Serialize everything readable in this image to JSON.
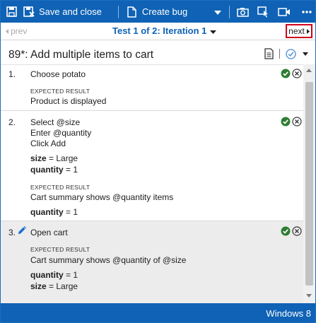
{
  "toolbar": {
    "save_close_label": "Save and close",
    "create_bug_label": "Create bug"
  },
  "nav": {
    "prev_label": "prev",
    "iteration_label": "Test 1 of 2: Iteration 1",
    "next_label": "next"
  },
  "test_case": {
    "title": "89*: Add multiple items to cart"
  },
  "expected_result_label": "EXPECTED RESULT",
  "steps": [
    {
      "number": "1.",
      "action": "Choose potato",
      "expected": "Product is displayed"
    },
    {
      "number": "2.",
      "action_lines": [
        "Select @size",
        "Enter @quantity",
        "Click Add"
      ],
      "params": [
        {
          "name": "size",
          "eq": " = ",
          "value": "Large"
        },
        {
          "name": "quantity",
          "eq": " = ",
          "value": "1"
        }
      ],
      "expected": "Cart summary shows @quantity items",
      "expected_params": [
        {
          "name": "quantity",
          "eq": " = ",
          "value": "1"
        }
      ]
    },
    {
      "number": "3.",
      "action": "Open cart",
      "expected": "Cart summary shows @quantity of @size",
      "expected_params": [
        {
          "name": "quantity",
          "eq": " = ",
          "value": "1"
        },
        {
          "name": "size",
          "eq": " = ",
          "value": "Large"
        }
      ]
    }
  ],
  "status": {
    "text": "Windows 8"
  },
  "colors": {
    "brand_blue": "#0f62b5",
    "pass_green": "#2e7d32",
    "highlight_red": "#d0021b"
  }
}
